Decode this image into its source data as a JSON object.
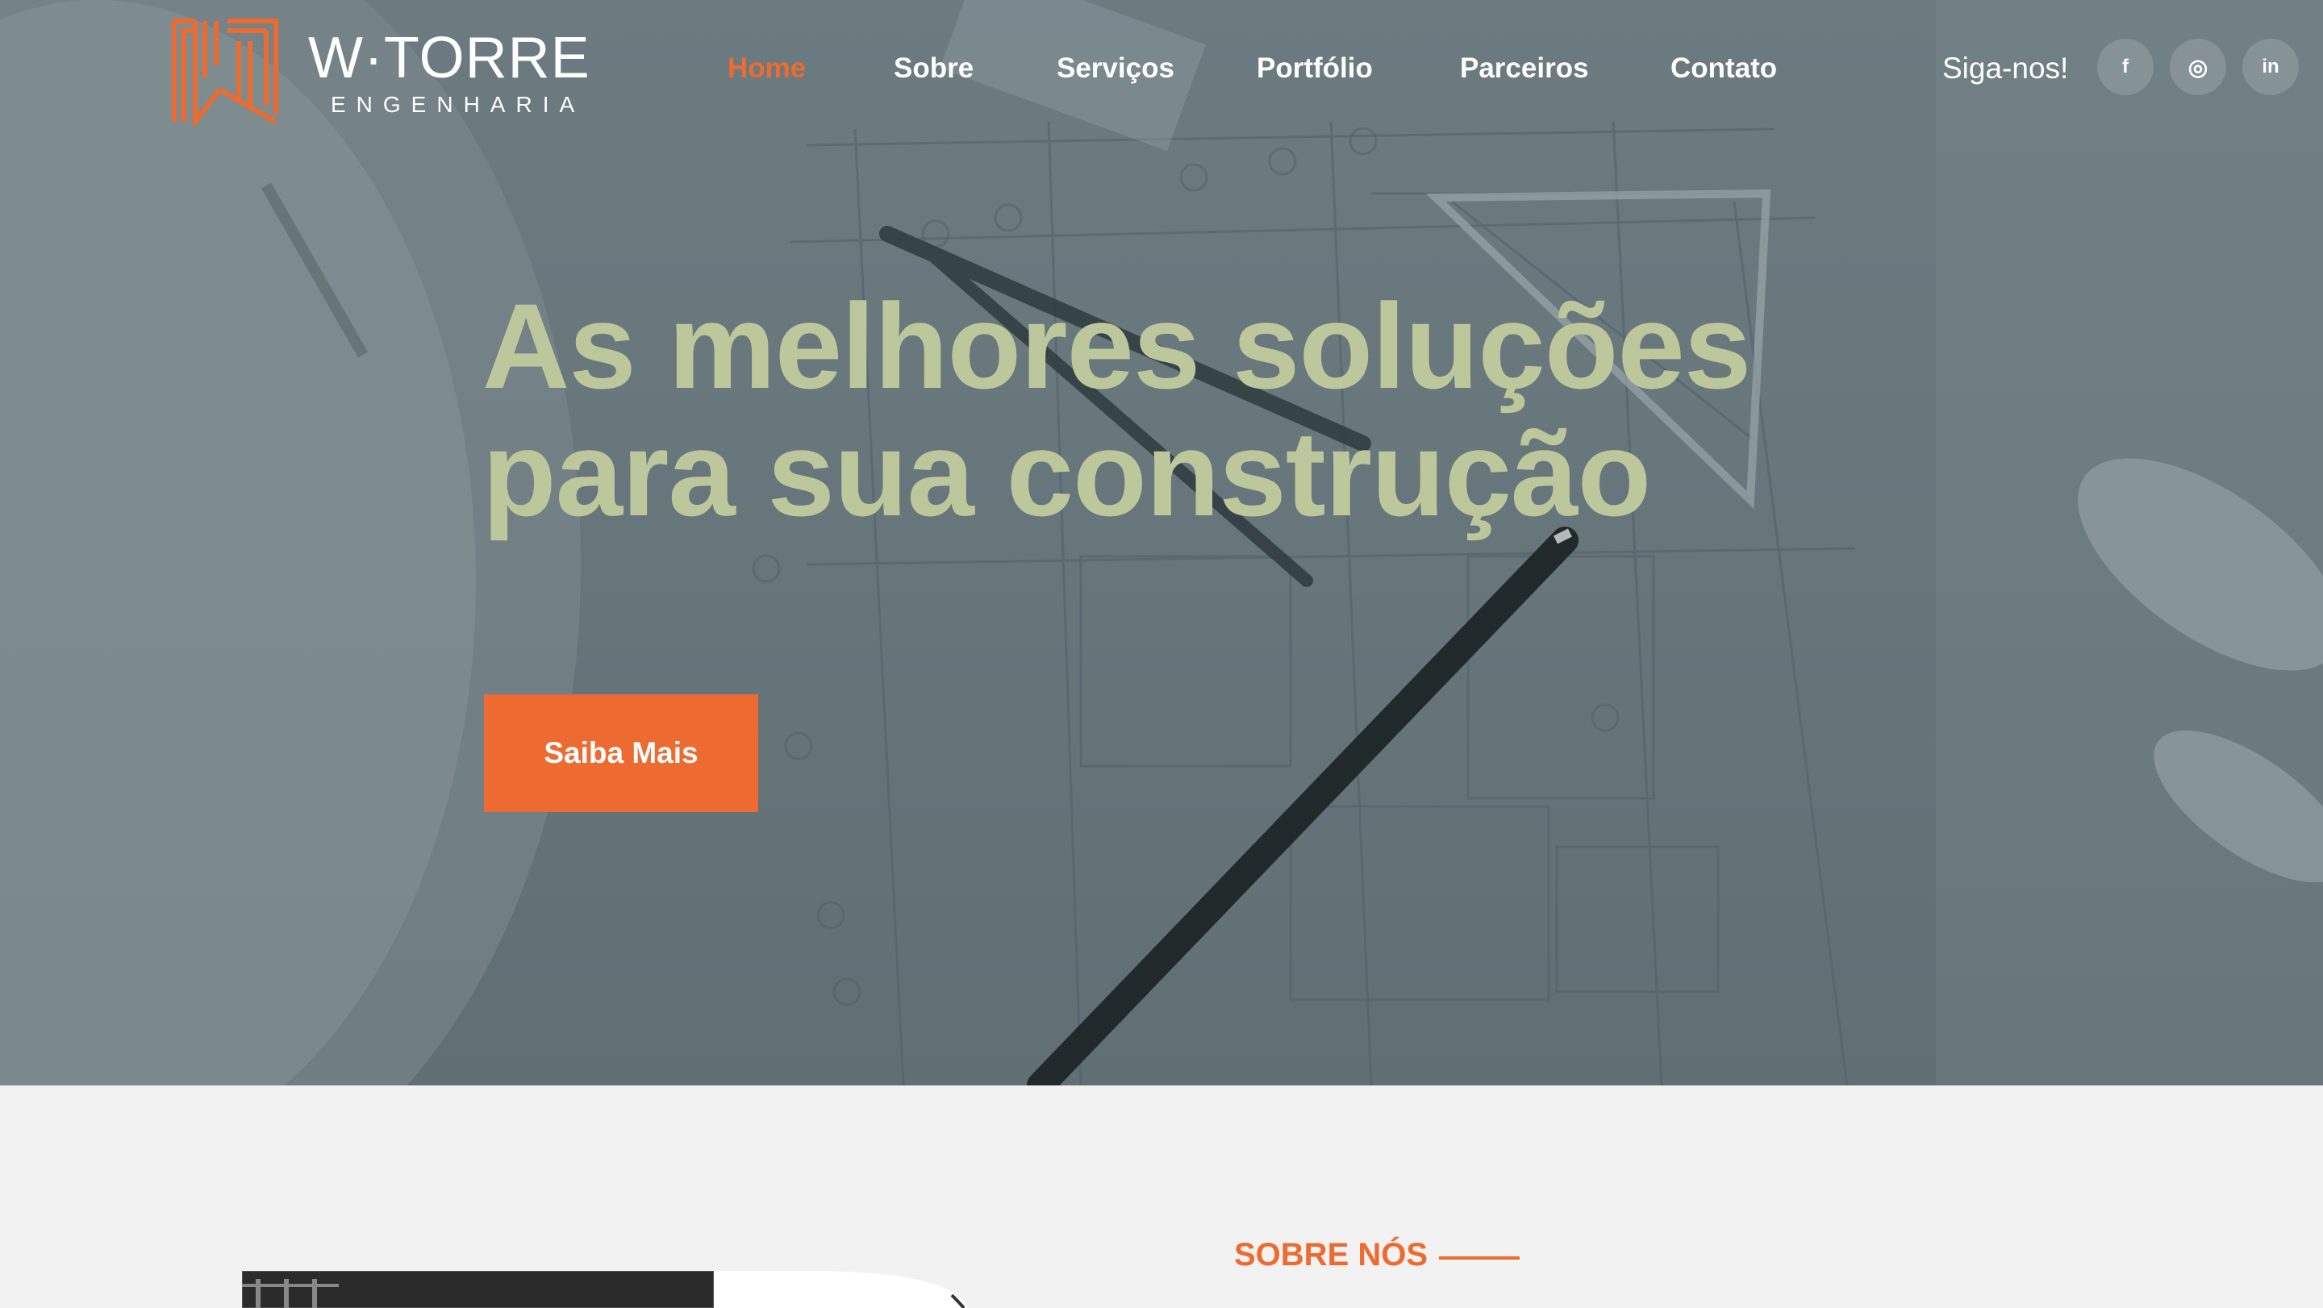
{
  "brand": {
    "name": "W·TORRE",
    "tagline": "ENGENHARIA",
    "accent_color": "#ed6b30",
    "headline_color": "#bcc79c"
  },
  "nav": {
    "items": [
      {
        "label": "Home",
        "active": true
      },
      {
        "label": "Sobre",
        "active": false
      },
      {
        "label": "Serviços",
        "active": false
      },
      {
        "label": "Portfólio",
        "active": false
      },
      {
        "label": "Parceiros",
        "active": false
      },
      {
        "label": "Contato",
        "active": false
      }
    ]
  },
  "social": {
    "label": "Siga-nos!",
    "links": [
      {
        "icon": "facebook-icon",
        "glyph": "f"
      },
      {
        "icon": "instagram-icon",
        "glyph": "◎"
      },
      {
        "icon": "linkedin-icon",
        "glyph": "in"
      }
    ]
  },
  "hero": {
    "title_line1": "As melhores soluções",
    "title_line2": "para sua construção",
    "cta_label": "Saiba Mais"
  },
  "about": {
    "section_label": "SOBRE NÓS"
  }
}
